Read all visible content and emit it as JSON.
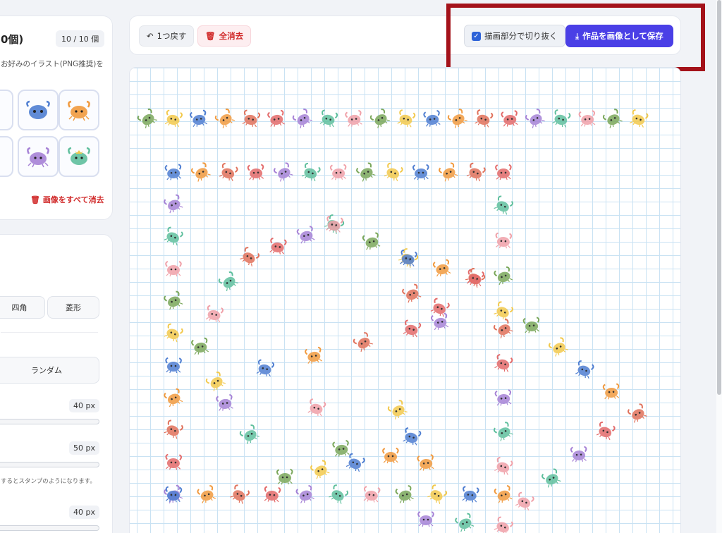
{
  "sidebar": {
    "images_title": "0個)",
    "images_count": "10 / 10 個",
    "images_desc": "お好みのイラスト(PNG推奨)を",
    "clear_images_label": "画像をすべて消去",
    "shape_square_label": "四角",
    "shape_diamond_label": "菱形",
    "random_label": "ランダム",
    "size_value": "40 px",
    "spacing_value": "50 px",
    "hint_text": "するとスタンプのようになります。",
    "third_value": "40 px",
    "thumbnails": [
      "#4f7ed1",
      "#f19a3e",
      "#a682d6",
      "#5fbf9d"
    ]
  },
  "toolbar": {
    "undo_label": "1つ戻す",
    "clear_all_label": "全消去",
    "crop_label": "描画部分で切り抜く",
    "crop_checked": true,
    "save_label": "作品を画像として保存"
  },
  "colors": {
    "accent": "#4a3fe6",
    "danger": "#d12b2b",
    "highlight": "#a4121a",
    "grid": "#c9e2f3"
  },
  "crab_palette": [
    "#7aa75a",
    "#f2c94c",
    "#4f7ed1",
    "#f19a3e",
    "#e0715b",
    "#e36a6a",
    "#a682d6",
    "#5fbf9d",
    "#f0a0a8"
  ]
}
